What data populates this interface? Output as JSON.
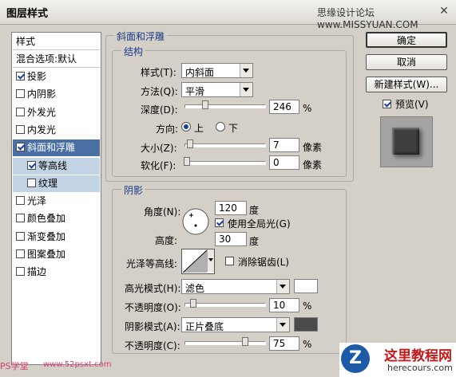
{
  "window": {
    "title": "图层样式",
    "watermark": "思缘设计论坛 www.MISSYUAN.COM"
  },
  "style_list": {
    "header": "样式",
    "blend": "混合选项:默认",
    "items": [
      {
        "label": "投影",
        "checked": true
      },
      {
        "label": "内阴影",
        "checked": false
      },
      {
        "label": "外发光",
        "checked": false
      },
      {
        "label": "内发光",
        "checked": false
      },
      {
        "label": "斜面和浮雕",
        "checked": true
      },
      {
        "label": "等高线",
        "checked": true
      },
      {
        "label": "纹理",
        "checked": false
      },
      {
        "label": "光泽",
        "checked": false
      },
      {
        "label": "颜色叠加",
        "checked": false
      },
      {
        "label": "渐变叠加",
        "checked": false
      },
      {
        "label": "图案叠加",
        "checked": false
      },
      {
        "label": "描边",
        "checked": false
      }
    ]
  },
  "bevel": {
    "group_title": "斜面和浮雕",
    "structure_title": "结构",
    "style_label": "样式(T):",
    "style_value": "内斜面",
    "method_label": "方法(Q):",
    "method_value": "平滑",
    "depth_label": "深度(D):",
    "depth_value": "246",
    "depth_unit": "%",
    "direction_label": "方向:",
    "dir_up": "上",
    "dir_down": "下",
    "size_label": "大小(Z):",
    "size_value": "7",
    "size_unit": "像素",
    "soften_label": "软化(F):",
    "soften_value": "0",
    "soften_unit": "像素"
  },
  "shading": {
    "title": "阴影",
    "angle_label": "角度(N):",
    "angle_value": "120",
    "angle_unit": "度",
    "global_light": "使用全局光(G)",
    "altitude_label": "高度:",
    "altitude_value": "30",
    "altitude_unit": "度",
    "gloss_label": "光泽等高线:",
    "antialias": "消除锯齿(L)",
    "highlight_label": "高光模式(H):",
    "highlight_value": "滤色",
    "highlight_color": "#ffffff",
    "opacity1_label": "不透明度(O):",
    "opacity1_value": "10",
    "opacity1_unit": "%",
    "shadow_label": "阴影模式(A):",
    "shadow_value": "正片叠底",
    "shadow_color": "#4a4a4a",
    "opacity2_label": "不透明度(C):",
    "opacity2_value": "75",
    "opacity2_unit": "%"
  },
  "buttons": {
    "ok": "确定",
    "cancel": "取消",
    "new_style": "新建样式(W)...",
    "preview": "预览(V)"
  },
  "footer": {
    "left_mark": "PS学堂",
    "left_url": "www.52psxt.com",
    "brand": "这里教程网",
    "brand_url": "herecours.com"
  }
}
